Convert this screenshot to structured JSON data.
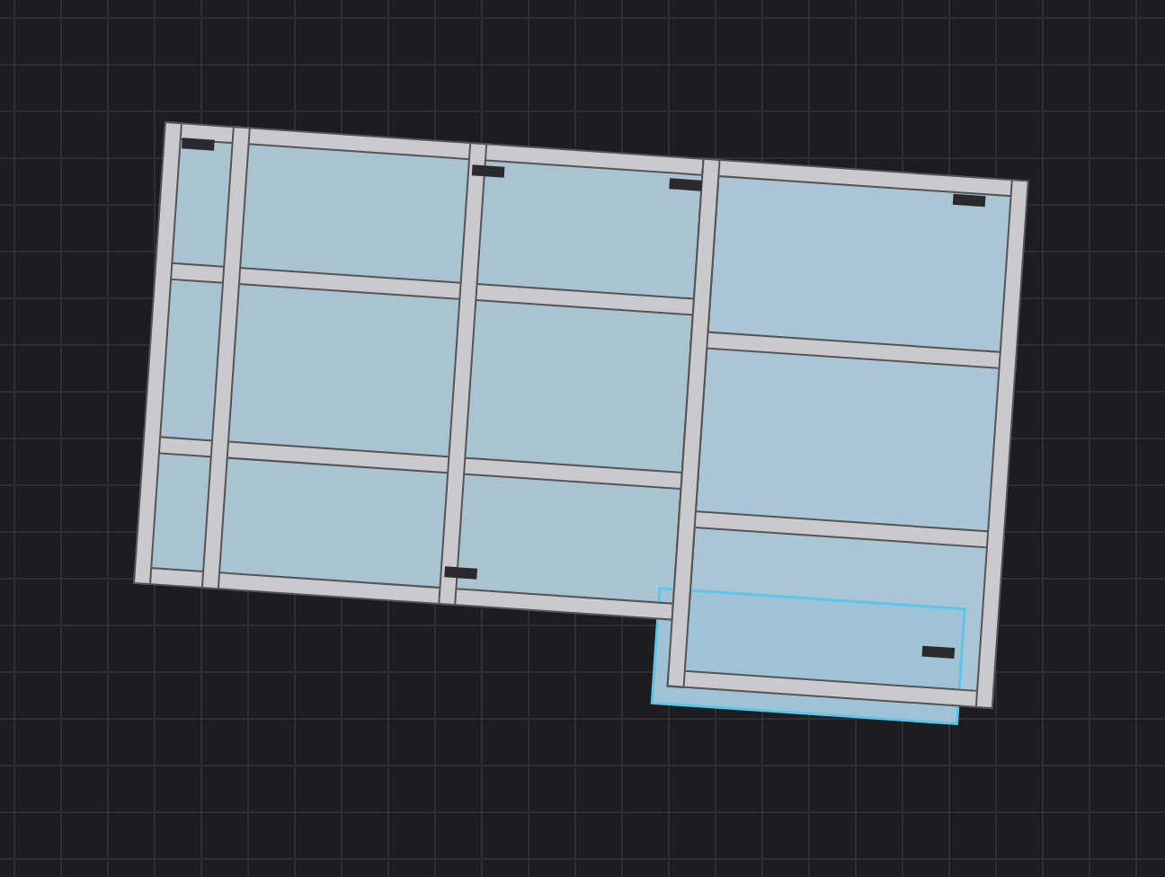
{
  "viewport": {
    "grid": true,
    "model": {
      "kind": "frame"
    }
  }
}
